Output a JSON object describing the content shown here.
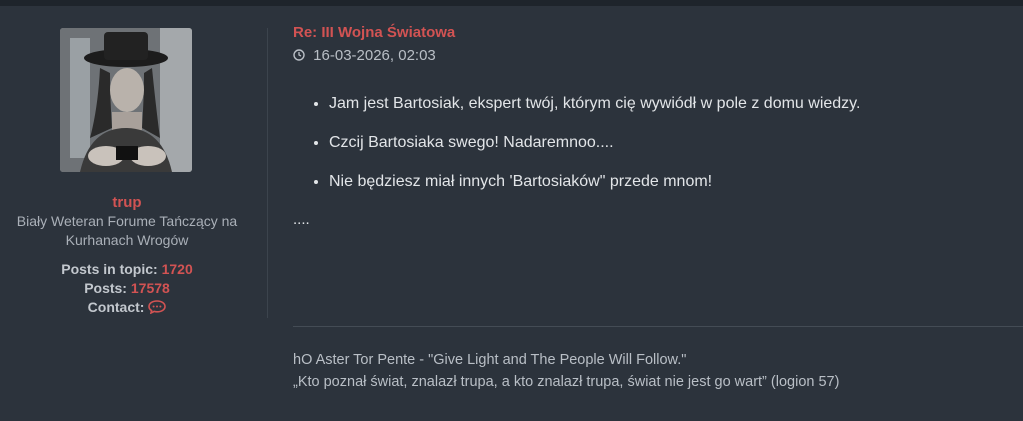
{
  "post": {
    "title": "Re: III Wojna Światowa",
    "date": "16-03-2026, 02:03",
    "bullets": [
      "Jam jest Bartosiak, ekspert twój, którym cię wywiódł w pole z domu wiedzy.",
      "Czcij Bartosiaka swego! Nadaremnoo....",
      "Nie będziesz miał innych 'Bartosiaków\" przede mnom!"
    ],
    "trailing": "...."
  },
  "author": {
    "username": "trup",
    "rank": "Biały Weteran Forume Tańczący na Kurhanach Wrogów",
    "posts_in_topic_label": "Posts in topic:",
    "posts_in_topic": "1720",
    "posts_label": "Posts:",
    "posts": "17578",
    "contact_label": "Contact:"
  },
  "signature": {
    "line1": "hO Aster Tor Pente - \"Give Light and The People Will Follow.\"",
    "line2": "„Kto poznał świat, znalazł trupa, a kto znalazł trupa, świat nie jest go wart” (logion 57)"
  },
  "icons": {
    "clock": "clock-icon",
    "contact": "speech-bubble-icon"
  },
  "colors": {
    "accent": "#d25353",
    "background": "#2c333c"
  }
}
